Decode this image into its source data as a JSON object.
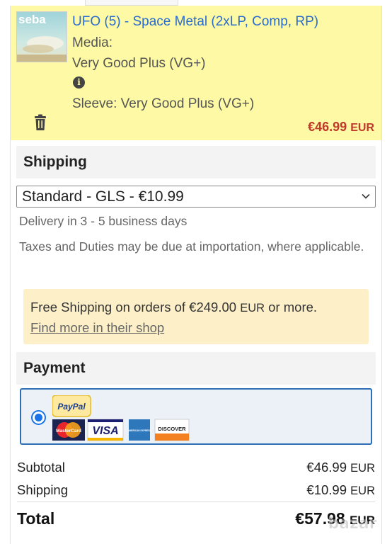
{
  "item": {
    "title": "UFO (5) - Space Metal (2xLP, Comp, RP)",
    "media_label": "Media:",
    "media_condition": "Very Good Plus (VG+)",
    "sleeve": "Sleeve: Very Good Plus (VG+)",
    "price": "€46.99",
    "price_currency": "EUR",
    "thumbnail_text": "seba"
  },
  "shipping": {
    "heading": "Shipping",
    "selected_option": "Standard - GLS - €10.99",
    "delivery": "Delivery in 3 - 5 business days",
    "taxes_note": "Taxes and Duties may be due at importation, where applicable.",
    "free_shipping_text": "Free Shipping on orders of €249.00",
    "free_shipping_currency": "EUR",
    "free_shipping_suffix": " or more.",
    "shop_link": "Find more in their shop"
  },
  "payment": {
    "heading": "Payment",
    "selected": true,
    "logos": {
      "paypal": "PayPal",
      "mastercard": "MasterCard",
      "visa": "VISA",
      "amex": "AMERICAN EXPRESS",
      "discover": "DISCOVER"
    }
  },
  "summary": {
    "subtotal_label": "Subtotal",
    "subtotal_value": "€46.99",
    "shipping_label": "Shipping",
    "shipping_value": "€10.99",
    "total_label": "Total",
    "total_value": "€57.98",
    "currency": "EUR"
  },
  "watermark": "bazar",
  "colors": {
    "item_highlight": "#fdf9a4",
    "link": "#2a6ccf",
    "price": "#c0392b",
    "notice_bg": "#fdf0c8",
    "payment_border": "#2c6fb7",
    "radio": "#1a73e8"
  }
}
